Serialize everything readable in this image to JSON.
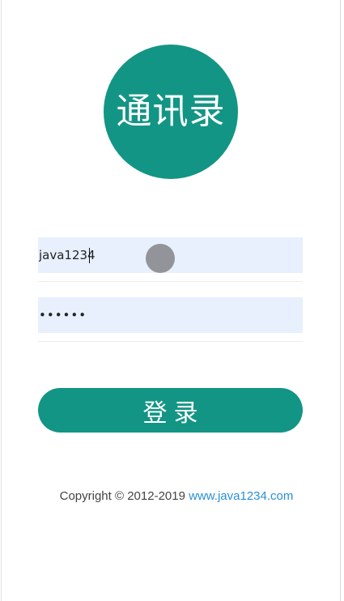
{
  "logo": {
    "text": "通讯录",
    "color": "#139585"
  },
  "form": {
    "username": {
      "value": "java1234",
      "placeholder": ""
    },
    "password": {
      "value": "123456",
      "placeholder": ""
    },
    "submit_label": "登录"
  },
  "footer": {
    "copyright": "Copyright © 2012-2019 ",
    "link_text": "www.java1234.com",
    "link_color": "#2b8fd6"
  },
  "colors": {
    "accent": "#139585",
    "input_background": "#e8f0fe"
  }
}
